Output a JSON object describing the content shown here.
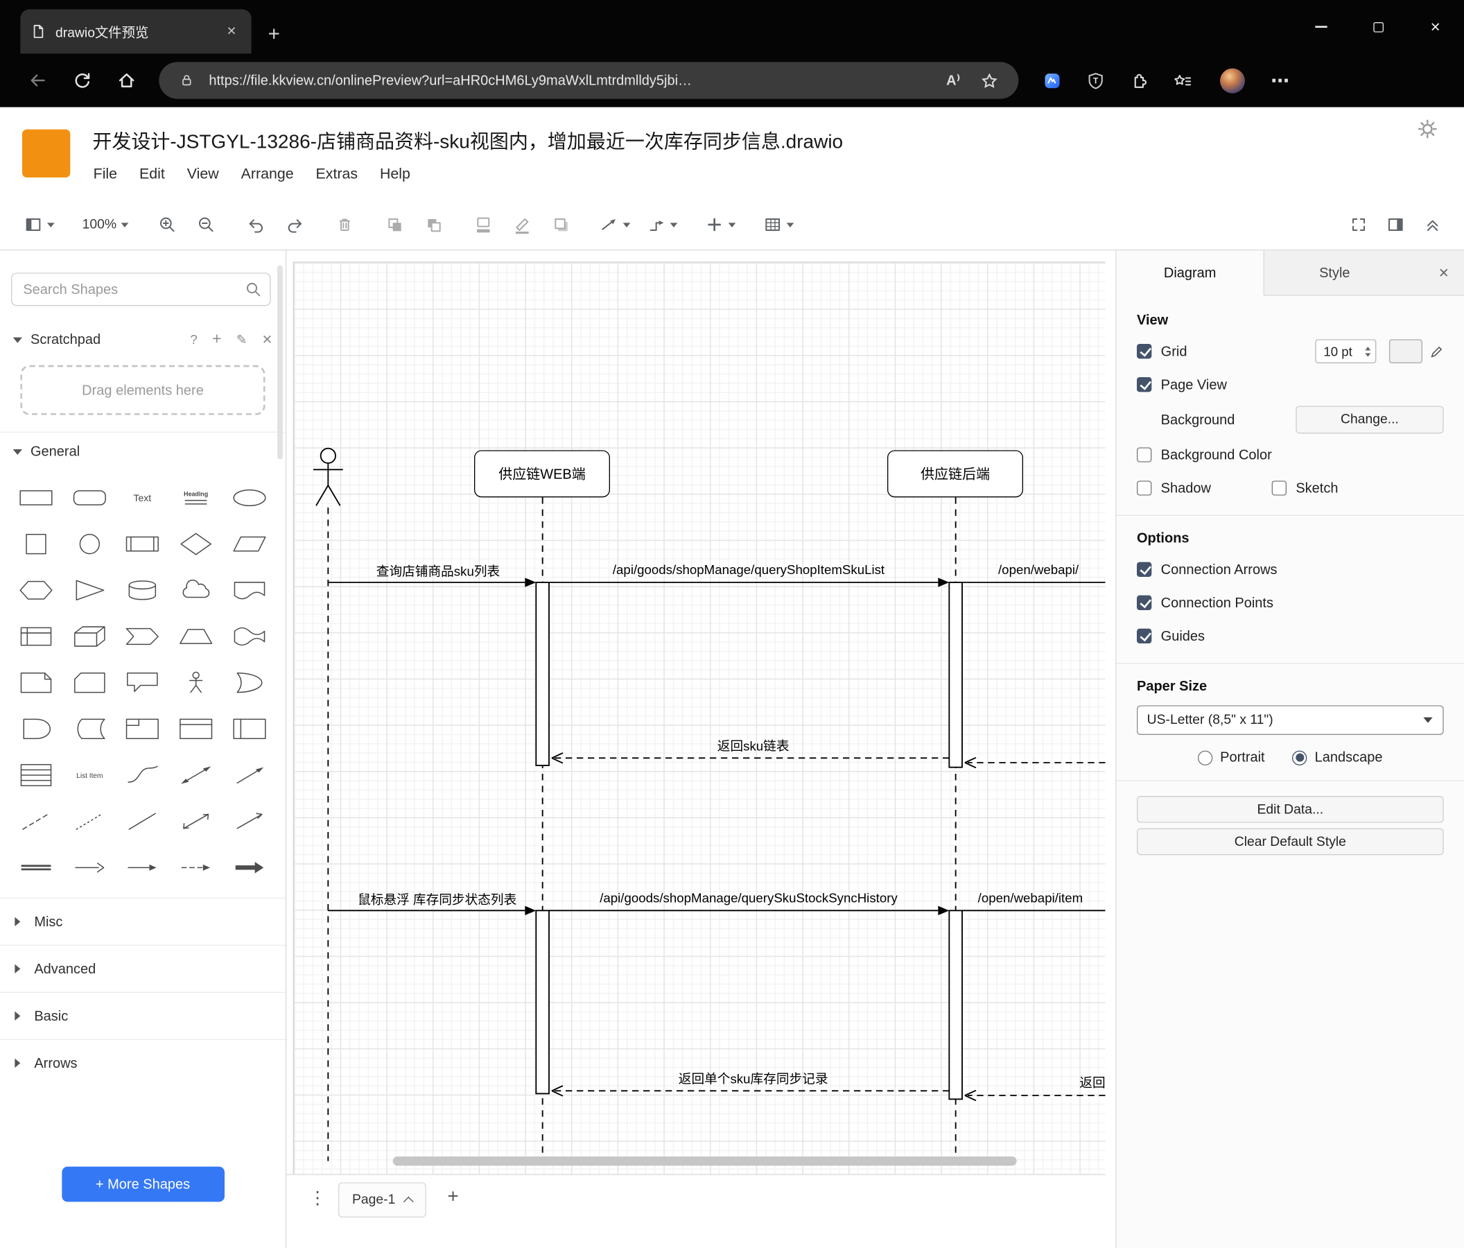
{
  "browser": {
    "tab_title": "drawio文件预览",
    "url": "https://file.kkview.cn/onlinePreview?url=aHR0cHM6Ly9maWxlLmtrdmlldy5jbi…"
  },
  "icons": {
    "close": "✕",
    "plus": "+",
    "kebab": "⋮",
    "more_dots": "⋯",
    "read_aloud": "A⁾",
    "help": "?",
    "pencil": "✎"
  },
  "app": {
    "title": "开发设计-JSTGYL-13286-店铺商品资料-sku视图内，增加最近一次库存同步信息.drawio",
    "menu": [
      "File",
      "Edit",
      "View",
      "Arrange",
      "Extras",
      "Help"
    ],
    "zoom_level": "100%"
  },
  "sidebar": {
    "search_placeholder": "Search Shapes",
    "scratchpad_title": "Scratchpad",
    "drag_hint": "Drag elements here",
    "general_title": "General",
    "collapsed_sections": [
      "Misc",
      "Advanced",
      "Basic",
      "Arrows"
    ],
    "more_shapes_label": "+ More Shapes",
    "shape_labels": {
      "text": "Text",
      "heading": "Heading",
      "list_item": "List Item"
    },
    "shapes": [
      "rectangle",
      "rounded-rectangle",
      "text",
      "heading",
      "ellipse",
      "square",
      "circle",
      "process",
      "diamond",
      "parallelogram",
      "hexagon",
      "triangle",
      "cylinder",
      "cloud",
      "document",
      "internal-storage",
      "cube",
      "step",
      "trapezoid",
      "tape",
      "note",
      "card",
      "callout",
      "actor",
      "or",
      "and",
      "data-storage",
      "container",
      "vertical-container",
      "horizontal-container",
      "list",
      "list-item",
      "curve",
      "bidirectional-arrow",
      "arrow",
      "dashed-line",
      "dotted-line",
      "line",
      "bidirectional-connector",
      "directional-connector",
      "link",
      "directional-arrow",
      "thin-arrow",
      "dashed-arrow",
      "filled-arrow"
    ]
  },
  "diagram": {
    "participants": [
      "供应链WEB端",
      "供应链后端"
    ],
    "messages": {
      "query_sku_list": "查询店铺商品sku列表",
      "api_query_shop_item_sku_list": "/api/goods/shopManage/queryShopItemSkuList",
      "open_webapi_1": "/open/webapi/",
      "return_sku_list": "返回sku链表",
      "hover_stock_sync": "鼠标悬浮 库存同步状态列表",
      "api_query_sku_stock_sync_history": "/api/goods/shopManage/querySkuStockSyncHistory",
      "open_webapi_2": "/open/webapi/item",
      "return_single_sku_record": "返回单个sku库存同步记录",
      "return_partial": "返回"
    }
  },
  "format_panel": {
    "tab_diagram": "Diagram",
    "tab_style": "Style",
    "view": {
      "heading": "View",
      "grid_label": "Grid",
      "grid_size": "10 pt",
      "grid_checked": true,
      "page_view_label": "Page View",
      "page_view_checked": true,
      "background_label": "Background",
      "change_button": "Change...",
      "background_color_label": "Background Color",
      "background_color_checked": false,
      "shadow_label": "Shadow",
      "shadow_checked": false,
      "sketch_label": "Sketch",
      "sketch_checked": false
    },
    "options": {
      "heading": "Options",
      "items": [
        {
          "label": "Connection Arrows",
          "checked": true
        },
        {
          "label": "Connection Points",
          "checked": true
        },
        {
          "label": "Guides",
          "checked": true
        }
      ]
    },
    "paper": {
      "heading": "Paper Size",
      "size_value": "US-Letter (8,5\" x 11\")",
      "portrait_label": "Portrait",
      "landscape_label": "Landscape",
      "orientation": "landscape"
    },
    "edit_data_button": "Edit Data...",
    "clear_style_button": "Clear Default Style"
  },
  "footer": {
    "page_tab": "Page-1"
  },
  "colors": {
    "logo_orange": "#F29111",
    "more_shapes_blue": "#3478F6",
    "selection_accent": "#44536A",
    "chrome_bg": "#050505",
    "pill_bg": "#3B3B3B"
  }
}
